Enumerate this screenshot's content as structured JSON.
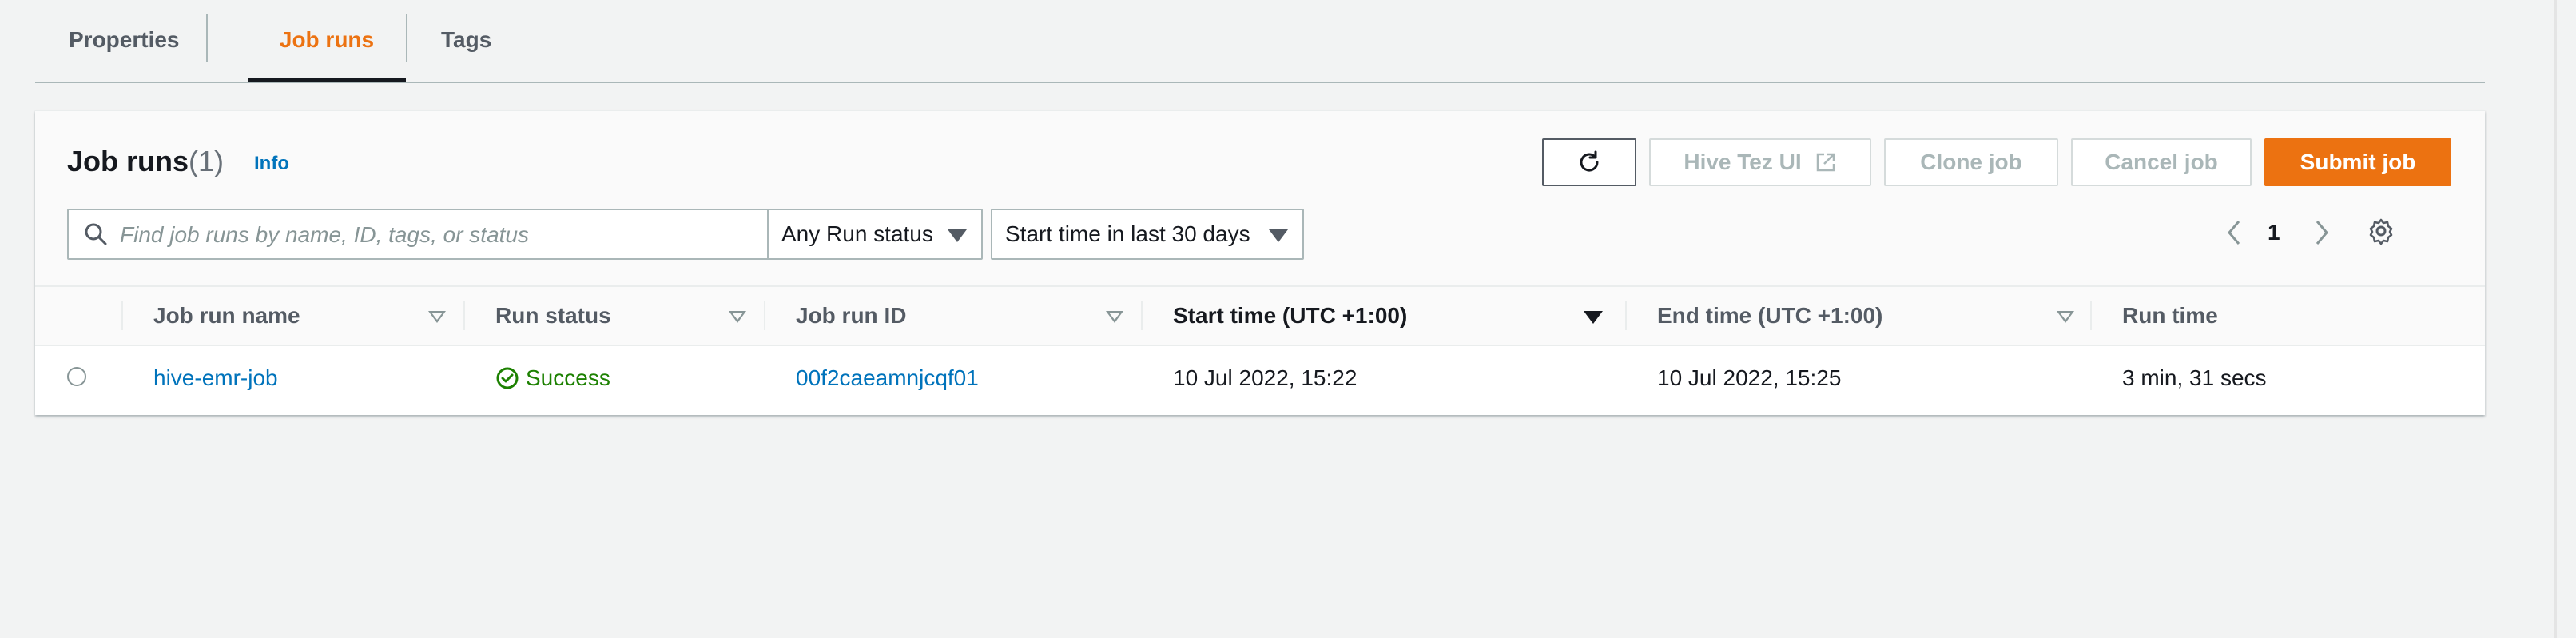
{
  "tabs": [
    {
      "label": "Properties"
    },
    {
      "label": "Job runs",
      "active": true
    },
    {
      "label": "Tags"
    }
  ],
  "header": {
    "title": "Job runs",
    "count": "(1)",
    "info_link": "Info"
  },
  "actions": {
    "hive_tez_ui": "Hive Tez UI",
    "clone_job": "Clone job",
    "cancel_job": "Cancel job",
    "submit_job": "Submit job"
  },
  "filters": {
    "search_placeholder": "Find job runs by name, ID, tags, or status",
    "run_status": "Any Run status",
    "time_range": "Start time in last 30 days"
  },
  "pagination": {
    "current_page": "1"
  },
  "table": {
    "columns": [
      "Job run name",
      "Run status",
      "Job run ID",
      "Start time (UTC +1:00)",
      "End time (UTC +1:00)",
      "Run time"
    ],
    "sorted_column": "Start time (UTC +1:00)",
    "rows": [
      {
        "name": "hive-emr-job",
        "status": "Success",
        "id": "00f2caeamnjcqf01",
        "start": "10 Jul 2022, 15:22",
        "end": "10 Jul 2022, 15:25",
        "run_time": "3 min, 31 secs"
      }
    ]
  },
  "colors": {
    "accent": "#ec7211",
    "link": "#0073bb",
    "success": "#1d8102",
    "background": "#f2f3f3"
  },
  "icons": {
    "refresh": "refresh-icon",
    "external": "external-link-icon",
    "search": "search-icon",
    "prev": "chevron-left-icon",
    "next": "chevron-right-icon",
    "settings": "gear-icon",
    "status": "check-circle-icon"
  }
}
